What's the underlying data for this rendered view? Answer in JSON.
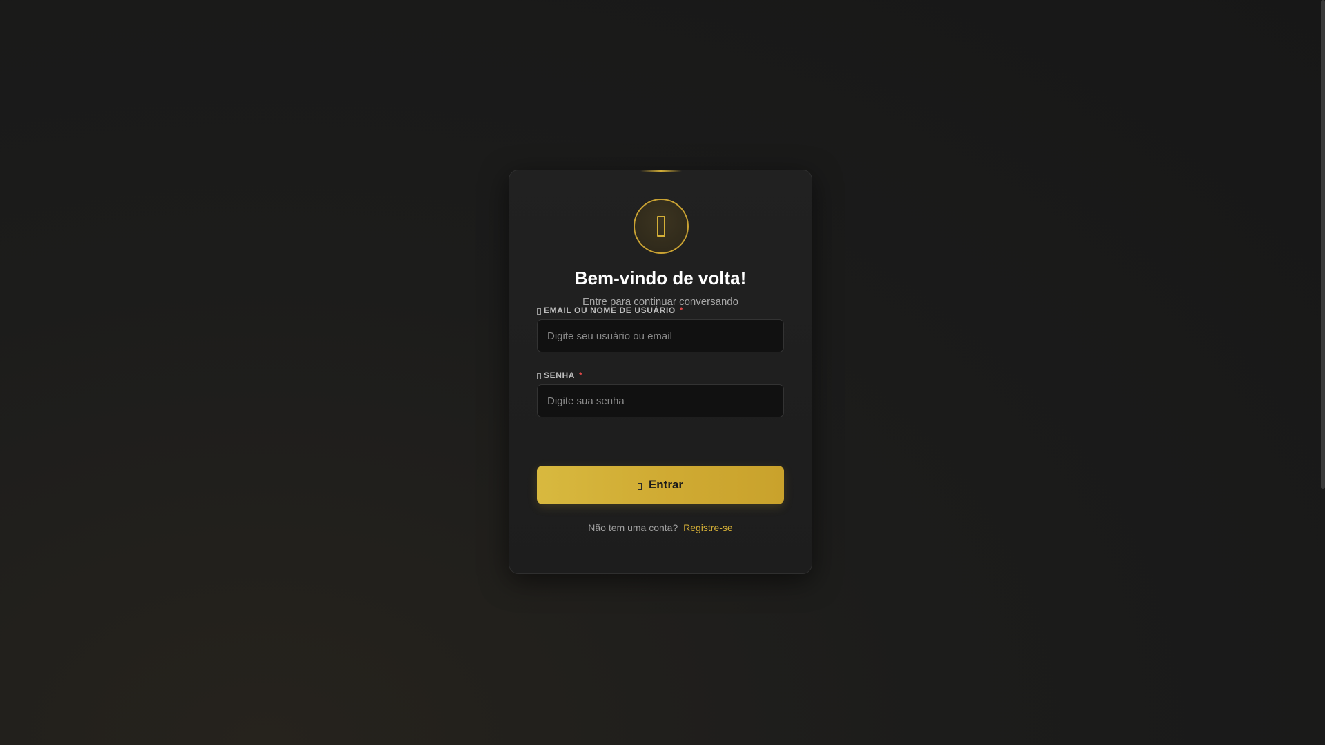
{
  "colors": {
    "accent": "#d4af37",
    "background": "#1c1c1b",
    "card": "#212121",
    "required": "#e04848"
  },
  "login": {
    "logo_icon": "mobile-phone-icon",
    "title": "Bem-vindo de volta!",
    "subtitle": "Entre para continuar conversando",
    "username": {
      "icon": "user-icon",
      "label": "EMAIL OU NOME DE USUÁRIO",
      "required_mark": "*",
      "placeholder": "Digite seu usuário ou email",
      "value": ""
    },
    "password": {
      "icon": "lock-icon",
      "label": "SENHA",
      "required_mark": "*",
      "placeholder": "Digite sua senha",
      "value": ""
    },
    "submit": {
      "icon": "sign-in-icon",
      "label": "Entrar"
    },
    "register": {
      "prompt": "Não tem uma conta?",
      "link_label": "Registre-se"
    }
  }
}
